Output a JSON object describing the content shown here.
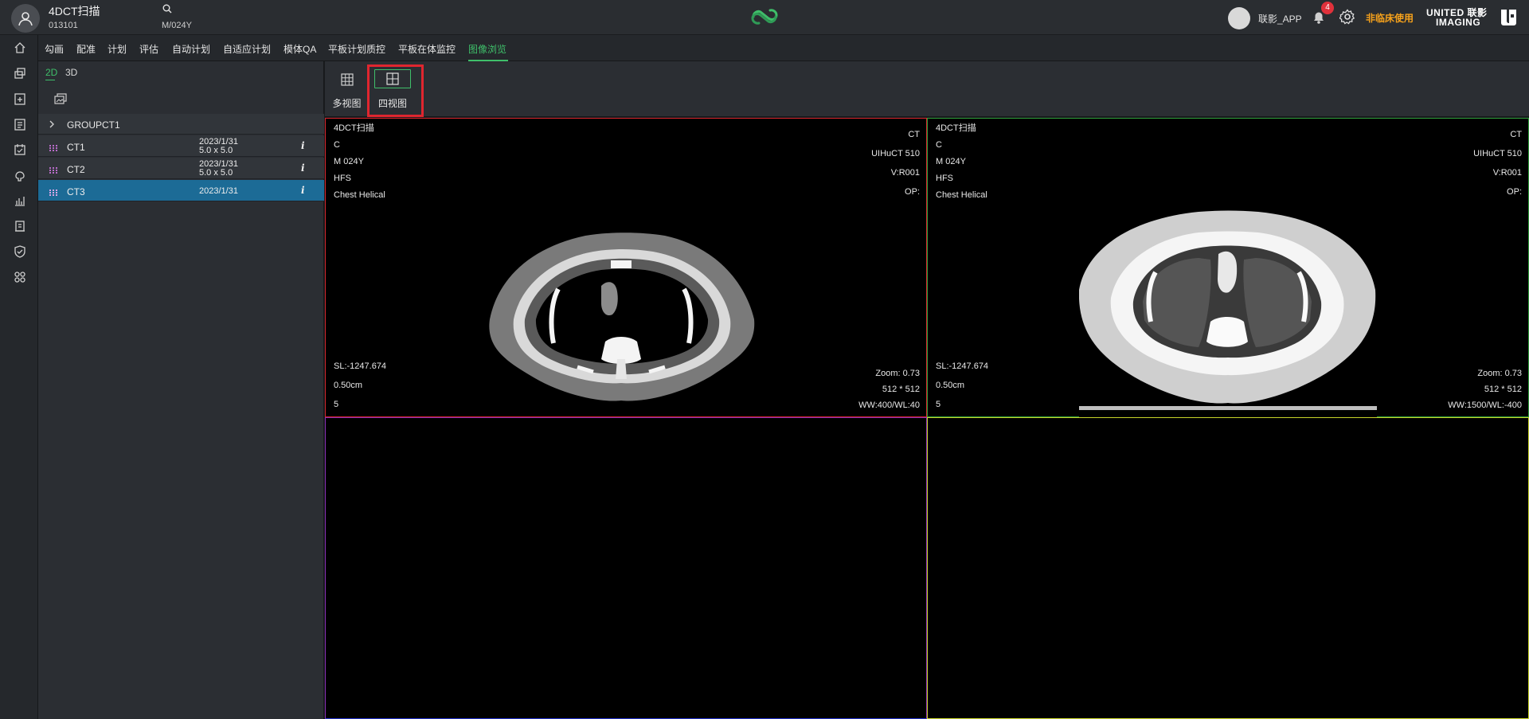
{
  "header": {
    "patient_name": "4DCT扫描",
    "patient_id": "013101",
    "patient_info": "M/024Y",
    "user_name": "联影_APP",
    "notification_count": "4",
    "non_clinical_label": "非临床使用",
    "brand_line1": "UNITED 联影",
    "brand_line2": "IMAGING"
  },
  "tabs": [
    "勾画",
    "配准",
    "计划",
    "评估",
    "自动计划",
    "自适应计划",
    "模体QA",
    "平板计划质控",
    "平板在体监控",
    "图像浏览"
  ],
  "active_tab": "图像浏览",
  "left_nav_icons": [
    "home-icon",
    "copy-icon",
    "clipboard-plus-icon",
    "document-list-icon",
    "calendar-check-icon",
    "brain-icon",
    "bar-chart-icon",
    "report-icon",
    "shield-check-icon",
    "apps-icon"
  ],
  "series_panel": {
    "mode_2d": "2D",
    "mode_3d": "3D",
    "group": "GROUPCT1",
    "series": [
      {
        "name": "CT1",
        "date": "2023/1/31",
        "spacing": "5.0 x 5.0",
        "info": "i",
        "selected": false
      },
      {
        "name": "CT2",
        "date": "2023/1/31",
        "spacing": "5.0 x 5.0",
        "info": "i",
        "selected": false
      },
      {
        "name": "CT3",
        "date": "2023/1/31",
        "spacing": "",
        "info": "i",
        "selected": true
      }
    ]
  },
  "layout_buttons": {
    "multi_view": "多视图",
    "four_view": "四视图"
  },
  "viewports": [
    {
      "tl": [
        "4DCT扫描",
        "C",
        "M 024Y",
        "HFS",
        "Chest Helical"
      ],
      "tr": [
        "CT",
        "UIHuCT 510",
        "V:R001",
        "OP:"
      ],
      "bl": [
        "SL:-1247.674",
        "0.50cm",
        "5"
      ],
      "br": [
        "Zoom: 0.73",
        "512 * 512",
        "WW:400/WL:40"
      ]
    },
    {
      "tl": [
        "4DCT扫描",
        "C",
        "M 024Y",
        "HFS",
        "Chest Helical"
      ],
      "tr": [
        "CT",
        "UIHuCT 510",
        "V:R001",
        "OP:"
      ],
      "bl": [
        "SL:-1247.674",
        "0.50cm",
        "5"
      ],
      "br": [
        "Zoom: 0.73",
        "512 * 512",
        "WW:1500/WL:-400"
      ]
    }
  ],
  "colors": {
    "accent": "#3fbf6a",
    "selected_row": "#1c6b96",
    "warning": "#f7a21b",
    "highlight": "#e0262f"
  }
}
